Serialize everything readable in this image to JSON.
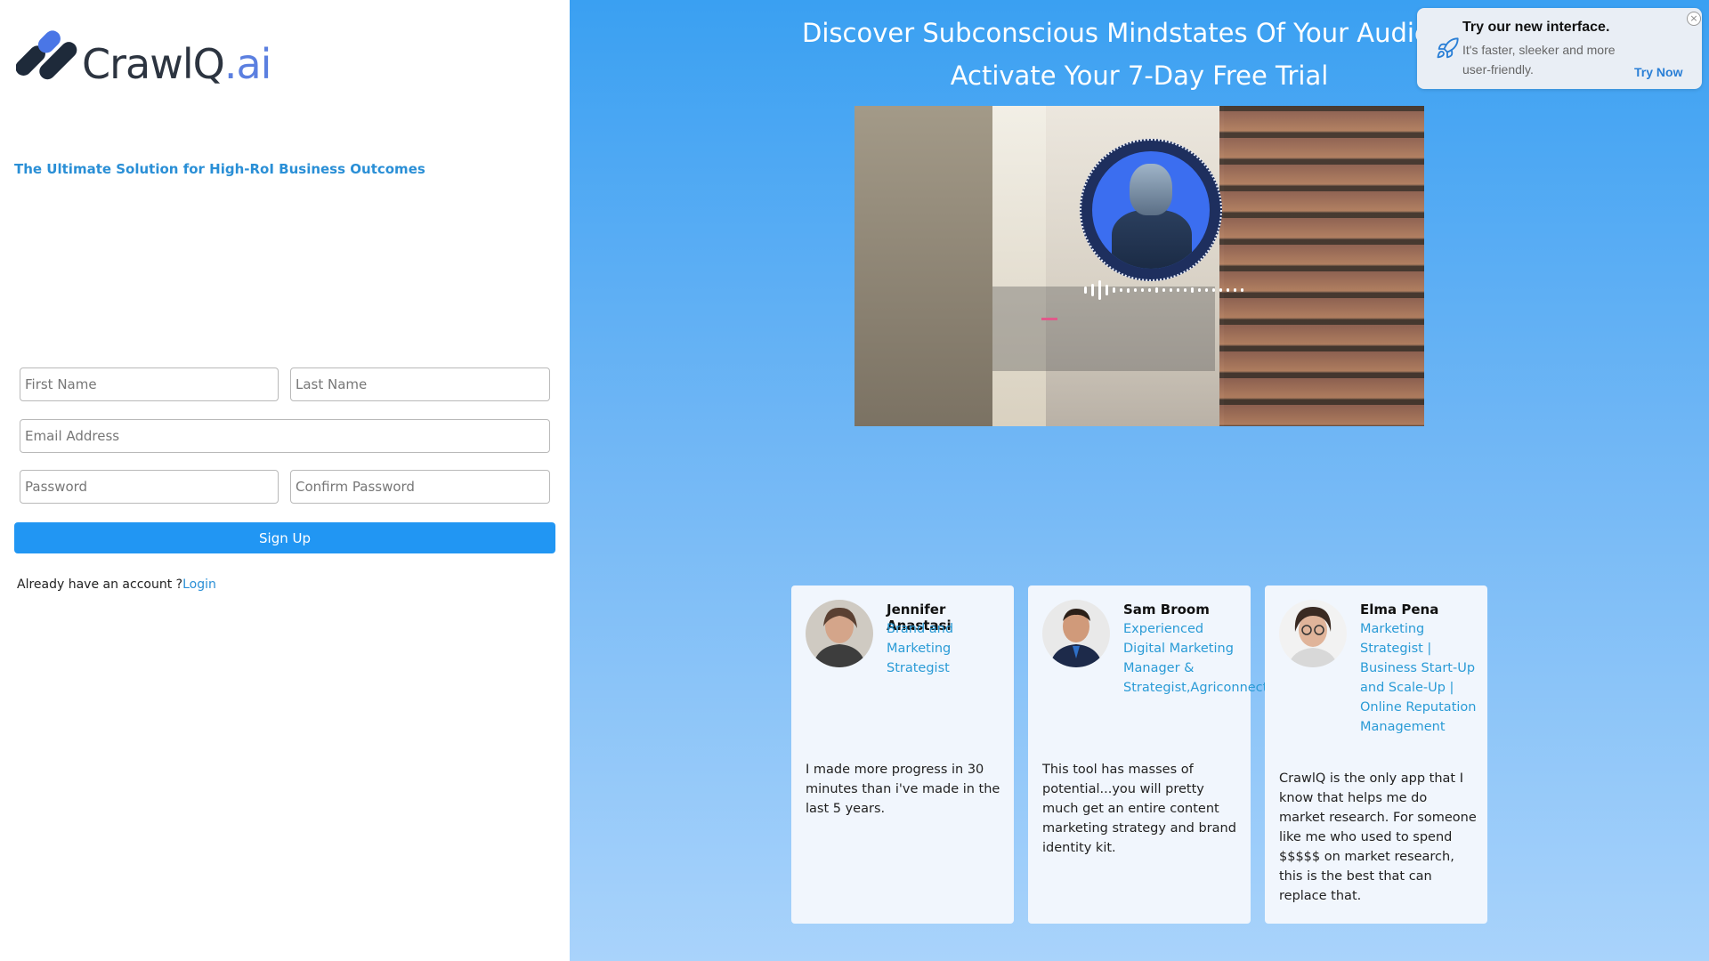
{
  "brand": {
    "name_main": "CrawlQ",
    "name_suffix": ".ai",
    "tagline": "The Ultimate Solution for High-RoI Business Outcomes"
  },
  "form": {
    "first_name_placeholder": "First Name",
    "last_name_placeholder": "Last Name",
    "email_placeholder": "Email Address",
    "password_placeholder": "Password",
    "confirm_password_placeholder": "Confirm Password",
    "signup_label": "Sign Up",
    "already_text": "Already have an account ?",
    "login_label": "Login"
  },
  "hero": {
    "headline": "Discover Subconscious Mindstates Of Your Audience",
    "subheadline": "Activate Your 7-Day Free Trial"
  },
  "testimonials": [
    {
      "name": "Jennifer Anastasi",
      "role": "Brand and Marketing Strategist",
      "quote": "I made more progress in 30 minutes than i've made in the last 5 years."
    },
    {
      "name": "Sam Broom",
      "role": "Experienced Digital Marketing Manager & Strategist,Agriconnect",
      "quote": "This tool has masses of potential...you will pretty much get an entire content marketing strategy and brand identity kit."
    },
    {
      "name": "Elma Pena",
      "role": "Marketing Strategist | Business Start-Up and Scale-Up | Online Reputation Management",
      "quote": "CrawlQ is the only app that I know that helps me do market research. For someone like me who used to spend $$$$$ on market research, this is the best that can replace that."
    }
  ],
  "toast": {
    "title": "Try our new interface.",
    "body": "It's faster, sleeker and more user-friendly.",
    "cta": "Try Now",
    "close": "×"
  },
  "colors": {
    "accent": "#2196f3",
    "link": "#2a8fd6",
    "logo_mark": "#1e2a3a"
  }
}
